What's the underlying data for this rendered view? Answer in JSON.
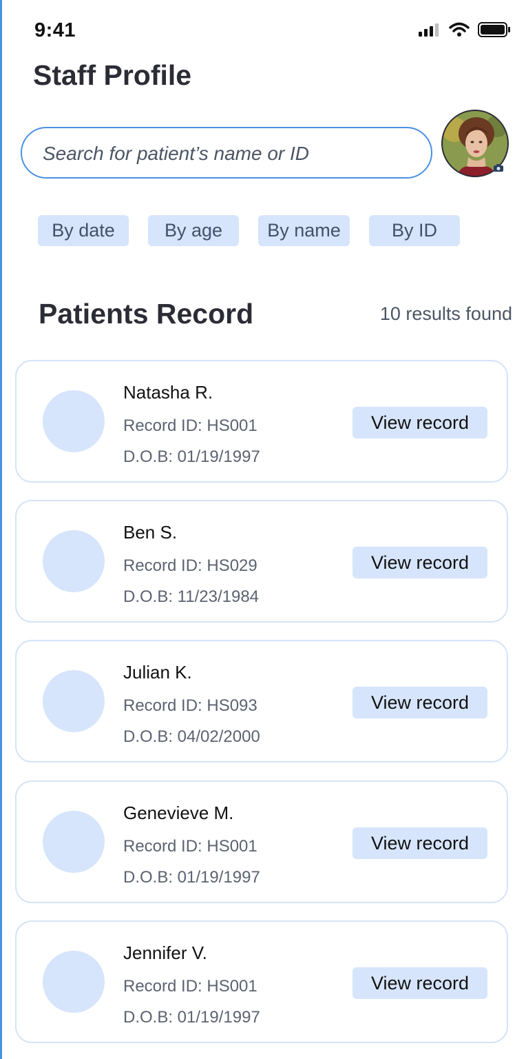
{
  "status_bar": {
    "time": "9:41"
  },
  "header": {
    "title": "Staff Profile"
  },
  "search": {
    "placeholder": "Search for patient’s name or ID"
  },
  "filters": [
    {
      "label": "By date"
    },
    {
      "label": "By age"
    },
    {
      "label": "By name"
    },
    {
      "label": "By ID"
    }
  ],
  "records": {
    "title": "Patients Record",
    "results_text": "10 results found",
    "items": [
      {
        "name": "Natasha R.",
        "record_id": "Record ID: HS001",
        "dob": "D.O.B: 01/19/1997",
        "button": "View record"
      },
      {
        "name": "Ben S.",
        "record_id": "Record ID: HS029",
        "dob": "D.O.B: 11/23/1984",
        "button": "View record"
      },
      {
        "name": "Julian K.",
        "record_id": "Record ID: HS093",
        "dob": "D.O.B: 04/02/2000",
        "button": "View record"
      },
      {
        "name": "Genevieve M.",
        "record_id": "Record ID: HS001",
        "dob": "D.O.B: 01/19/1997",
        "button": "View record"
      },
      {
        "name": "Jennifer V.",
        "record_id": "Record ID: HS001",
        "dob": "D.O.B: 01/19/1997",
        "button": "View record"
      }
    ]
  },
  "colors": {
    "accent": "#4a90e2",
    "chip_bg": "#d6e5fb",
    "card_border": "#d5e4f7",
    "title_text": "#2c2c36"
  },
  "icons": {
    "status": [
      "signal-icon",
      "wifi-icon",
      "battery-icon"
    ],
    "avatar_badge": "camera-icon"
  }
}
